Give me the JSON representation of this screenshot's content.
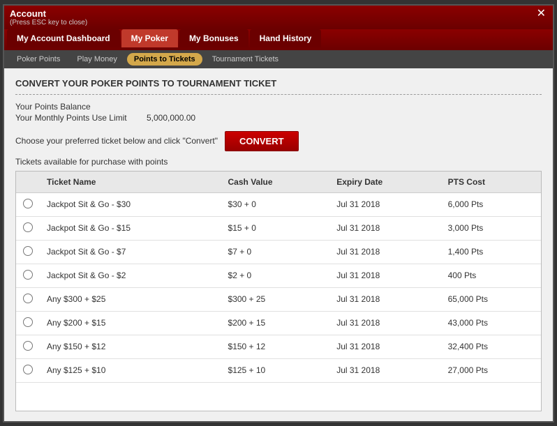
{
  "window": {
    "title": "Account",
    "subtitle": "(Press ESC key to close)",
    "close_label": "✕"
  },
  "main_tabs": [
    {
      "id": "account-dashboard",
      "label": "My Account Dashboard",
      "active": false
    },
    {
      "id": "my-poker",
      "label": "My Poker",
      "active": true
    },
    {
      "id": "my-bonuses",
      "label": "My Bonuses",
      "active": false
    },
    {
      "id": "hand-history",
      "label": "Hand History",
      "active": false
    }
  ],
  "sub_tabs": [
    {
      "id": "poker-points",
      "label": "Poker Points",
      "active": false
    },
    {
      "id": "play-money",
      "label": "Play Money",
      "active": false
    },
    {
      "id": "points-to-tickets",
      "label": "Points to Tickets",
      "active": true
    },
    {
      "id": "tournament-tickets",
      "label": "Tournament Tickets",
      "active": false
    }
  ],
  "section_title": "CONVERT YOUR POKER POINTS TO TOURNAMENT TICKET",
  "info": {
    "balance_label": "Your Points Balance",
    "limit_label": "Your Monthly Points Use Limit",
    "limit_value": "5,000,000.00"
  },
  "convert_row": {
    "text": "Choose your preferred ticket below and click \"Convert\"",
    "button_label": "CONVERT"
  },
  "available_text": "Tickets available for purchase with points",
  "table": {
    "headers": [
      "",
      "Ticket Name",
      "Cash Value",
      "Expiry Date",
      "PTS Cost"
    ],
    "rows": [
      {
        "name": "Jackpot Sit & Go - $30",
        "cash_value": "$30 + 0",
        "expiry": "Jul 31 2018",
        "pts_cost": "6,000 Pts"
      },
      {
        "name": "Jackpot Sit & Go - $15",
        "cash_value": "$15 + 0",
        "expiry": "Jul 31 2018",
        "pts_cost": "3,000 Pts"
      },
      {
        "name": "Jackpot Sit & Go - $7",
        "cash_value": "$7 + 0",
        "expiry": "Jul 31 2018",
        "pts_cost": "1,400 Pts"
      },
      {
        "name": "Jackpot Sit & Go - $2",
        "cash_value": "$2 + 0",
        "expiry": "Jul 31 2018",
        "pts_cost": "400 Pts"
      },
      {
        "name": "Any $300 + $25",
        "cash_value": "$300 + 25",
        "expiry": "Jul 31 2018",
        "pts_cost": "65,000 Pts"
      },
      {
        "name": "Any $200 + $15",
        "cash_value": "$200 + 15",
        "expiry": "Jul 31 2018",
        "pts_cost": "43,000 Pts"
      },
      {
        "name": "Any $150 + $12",
        "cash_value": "$150 + 12",
        "expiry": "Jul 31 2018",
        "pts_cost": "32,400 Pts"
      },
      {
        "name": "Any $125 + $10",
        "cash_value": "$125 + 10",
        "expiry": "Jul 31 2018",
        "pts_cost": "27,000 Pts"
      }
    ]
  }
}
